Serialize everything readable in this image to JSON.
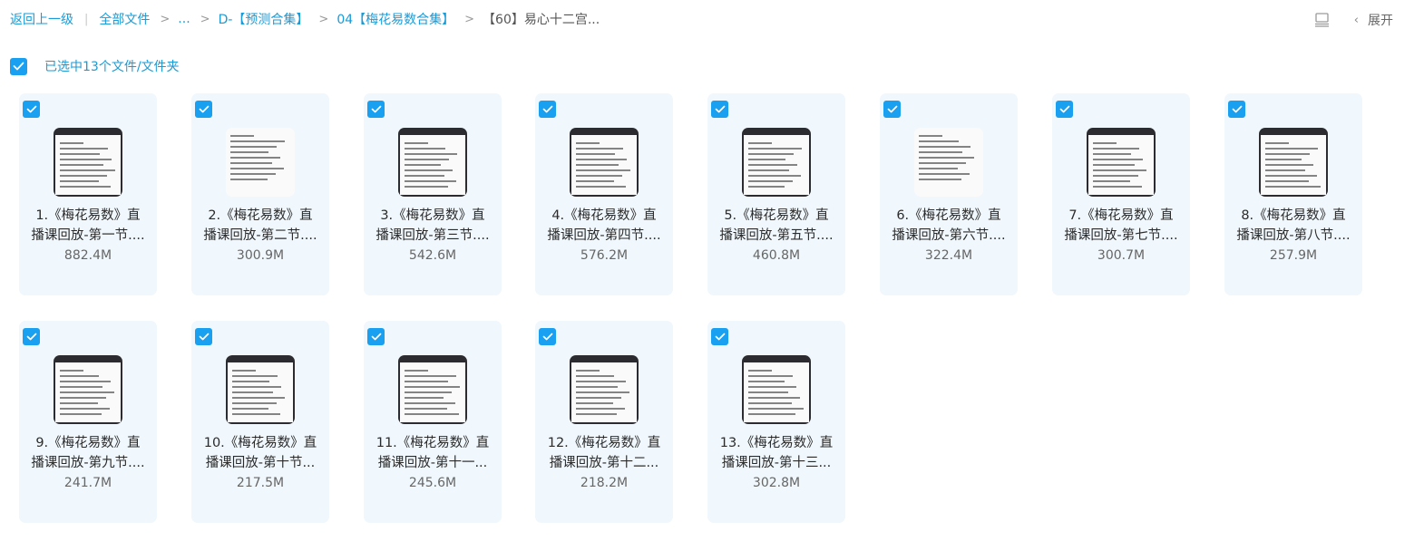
{
  "breadcrumb": {
    "back": "返回上一级",
    "all_files": "全部文件",
    "ellipsis": "...",
    "folder1": "D-【预测合集】",
    "folder2": "04【梅花易数合集】",
    "current": "【60】易心十二宫...",
    "bar": "|",
    "sep": ">"
  },
  "toolbar": {
    "chevron": "‹",
    "expand_label": "展开",
    "layout_icon": "list-view-icon"
  },
  "selection": {
    "label": "已选中13个文件/文件夹"
  },
  "colors": {
    "accent": "#1aa0f0",
    "link": "#1a9bd7",
    "card_bg": "#f0f8fd"
  },
  "files": [
    {
      "line1": "1.《梅花易数》直",
      "line2": "播课回放-第一节....",
      "size": "882.4M"
    },
    {
      "line1": "2.《梅花易数》直",
      "line2": "播课回放-第二节....",
      "size": "300.9M"
    },
    {
      "line1": "3.《梅花易数》直",
      "line2": "播课回放-第三节....",
      "size": "542.6M"
    },
    {
      "line1": "4.《梅花易数》直",
      "line2": "播课回放-第四节....",
      "size": "576.2M"
    },
    {
      "line1": "5.《梅花易数》直",
      "line2": "播课回放-第五节....",
      "size": "460.8M"
    },
    {
      "line1": "6.《梅花易数》直",
      "line2": "播课回放-第六节....",
      "size": "322.4M"
    },
    {
      "line1": "7.《梅花易数》直",
      "line2": "播课回放-第七节....",
      "size": "300.7M"
    },
    {
      "line1": "8.《梅花易数》直",
      "line2": "播课回放-第八节....",
      "size": "257.9M"
    },
    {
      "line1": "9.《梅花易数》直",
      "line2": "播课回放-第九节....",
      "size": "241.7M"
    },
    {
      "line1": "10.《梅花易数》直",
      "line2": "播课回放-第十节...",
      "size": "217.5M"
    },
    {
      "line1": "11.《梅花易数》直",
      "line2": "播课回放-第十一...",
      "size": "245.6M"
    },
    {
      "line1": "12.《梅花易数》直",
      "line2": "播课回放-第十二...",
      "size": "218.2M"
    },
    {
      "line1": "13.《梅花易数》直",
      "line2": "播课回放-第十三...",
      "size": "302.8M"
    }
  ]
}
